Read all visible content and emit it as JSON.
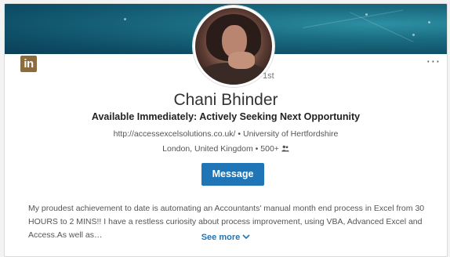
{
  "banner": {
    "background_colors": [
      "#0b3f57",
      "#1b6d82",
      "#2d8fa3"
    ]
  },
  "logo": {
    "text": "in",
    "icon": "linkedin-logo-icon",
    "color": "#8c6b3e"
  },
  "more_menu": {
    "label": "···",
    "icon": "ellipsis-icon"
  },
  "profile": {
    "photo_icon": "profile-photo",
    "degree": "1st",
    "name": "Chani Bhinder",
    "headline": "Available Immediately: Actively Seeking Next Opportunity",
    "website": "http://accessexcelsolutions.co.uk/",
    "separator": "•",
    "education": "University of Hertfordshire",
    "location": "London, United Kingdom",
    "connections": "500+",
    "connections_icon": "people-icon"
  },
  "actions": {
    "message_label": "Message",
    "accent": "#1f75b5"
  },
  "summary": {
    "text": "My proudest achievement to date is automating an Accountants' manual month end process in Excel from 30 HOURS to 2 MINS!! I have a restless curiosity about process improvement, using VBA, Advanced Excel and Access.As well as…",
    "see_more_label": "See more",
    "see_more_icon": "chevron-down-icon"
  }
}
